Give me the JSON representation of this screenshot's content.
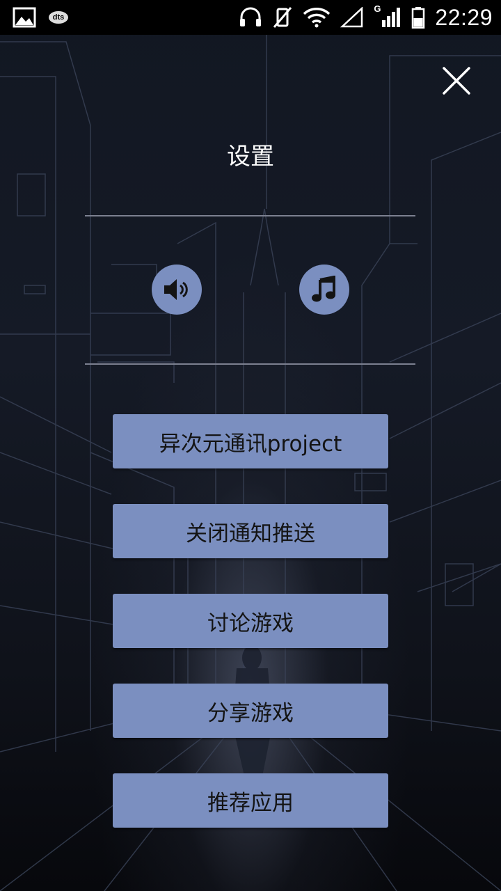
{
  "status_bar": {
    "time": "22:29",
    "dts_label": "dts",
    "network_label": "G",
    "icons": [
      "image-icon",
      "dts-icon",
      "headphones-icon",
      "vibrate-off-icon",
      "wifi-icon",
      "signal-empty-icon",
      "signal-icon",
      "battery-icon"
    ]
  },
  "settings": {
    "title": "设置",
    "close_icon": "close-icon",
    "sound_icon": "speaker-icon",
    "music_icon": "music-note-icon"
  },
  "menu": {
    "items": [
      {
        "label": "异次元通讯project"
      },
      {
        "label": "关闭通知推送"
      },
      {
        "label": "讨论游戏"
      },
      {
        "label": "分享游戏"
      },
      {
        "label": "推荐应用"
      }
    ]
  },
  "colors": {
    "button_bg": "#7b8fc0",
    "button_text": "#141414",
    "title_text": "#ffffff",
    "background": "#121722"
  }
}
